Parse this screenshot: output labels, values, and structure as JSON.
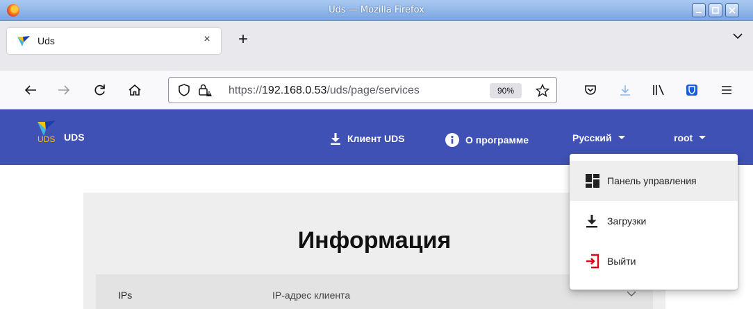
{
  "window": {
    "title": "Uds — Mozilla Firefox"
  },
  "tab": {
    "title": "Uds",
    "close_glyph": "×",
    "new_tab_glyph": "+"
  },
  "navbar": {
    "url_prefix": "https://",
    "url_host": "192.168.0.53",
    "url_path": "/uds/page/services",
    "zoom": "90%"
  },
  "app": {
    "brand": "UDS",
    "logo_text": "UDS",
    "client_label": "Клиент UDS",
    "about_label": "О программе",
    "language_label": "Русский",
    "user_label": "root",
    "accent_color": "#3f51b5"
  },
  "user_menu": {
    "items": [
      {
        "label": "Панель управления",
        "icon": "dashboard-icon"
      },
      {
        "label": "Загрузки",
        "icon": "download-icon"
      },
      {
        "label": "Выйти",
        "icon": "logout-icon"
      }
    ]
  },
  "content": {
    "heading": "Информация",
    "row_key": "IPs",
    "row_value": "IP-адрес клиента"
  }
}
